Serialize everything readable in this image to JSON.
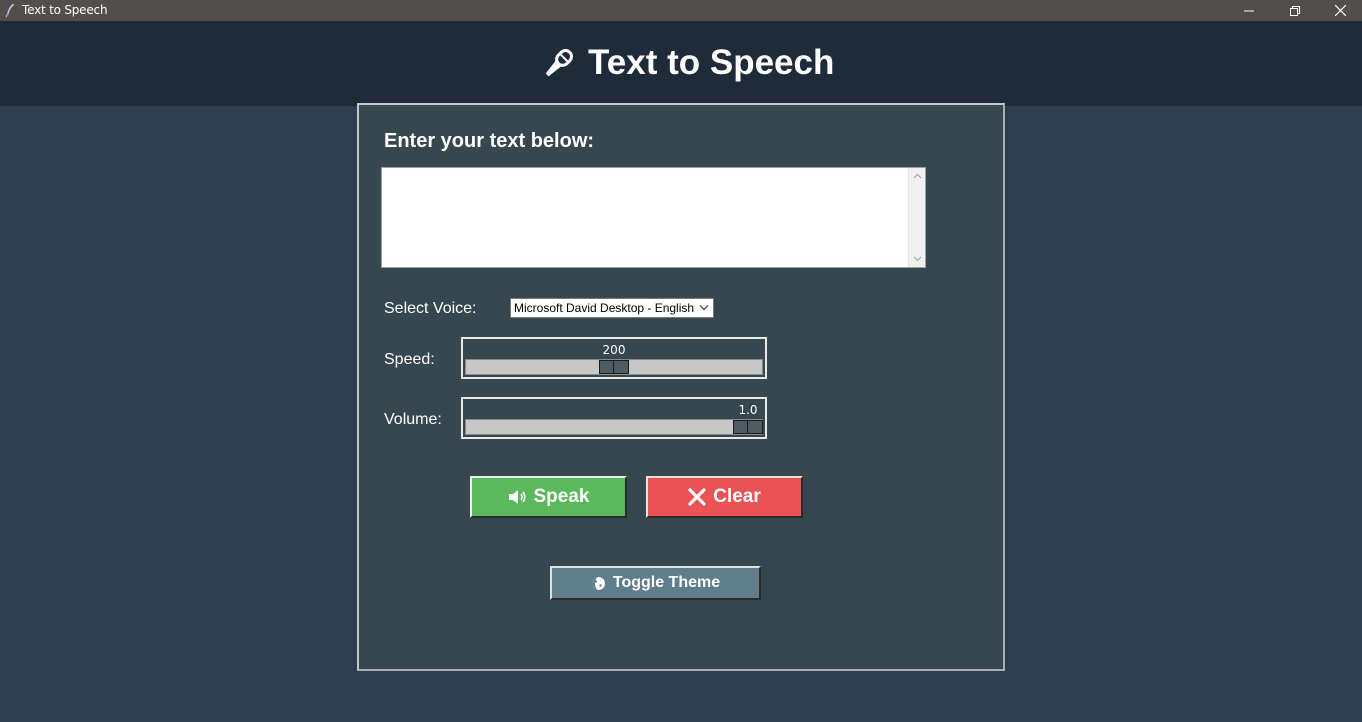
{
  "window": {
    "title": "Text to Speech"
  },
  "header": {
    "title": "Text to Speech",
    "icon": "microphone-icon"
  },
  "main": {
    "prompt_label": "Enter your text below:",
    "text_input_value": "",
    "voice": {
      "label": "Select Voice:",
      "selected": "Microsoft David Desktop - English"
    },
    "speed": {
      "label": "Speed:",
      "value": "200",
      "fraction": 0.5
    },
    "volume": {
      "label": "Volume:",
      "value": "1.0",
      "fraction": 1.0
    },
    "buttons": {
      "speak": "Speak",
      "clear": "Clear",
      "toggle_theme": "Toggle Theme"
    }
  },
  "colors": {
    "background": "#2c3e50",
    "header": "#1f2b3a",
    "panel": "#37474f",
    "speak": "#5cb85c",
    "clear": "#e95353",
    "toggle": "#607d8b"
  }
}
